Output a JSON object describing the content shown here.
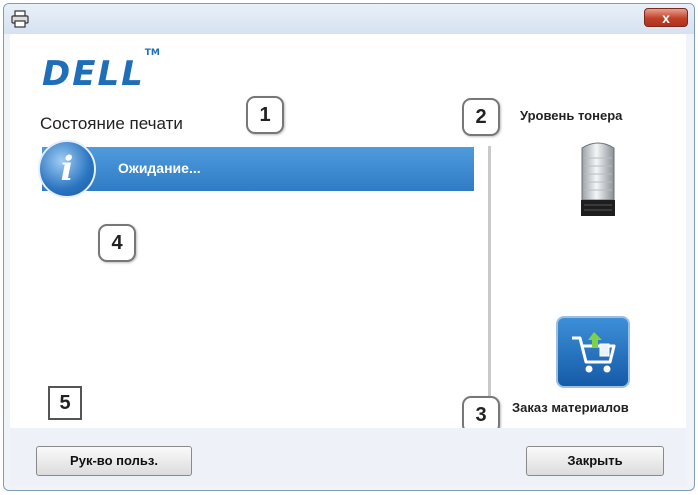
{
  "window": {
    "title_icon": "printer-icon",
    "close_label": "x"
  },
  "brand": {
    "logo_text": "DELL",
    "trademark": "TM"
  },
  "status_panel": {
    "heading": "Состояние печати",
    "status_icon": "info-icon",
    "status_icon_glyph": "i",
    "status_text": "Ожидание...",
    "status_bar_color": "#2f7cc5"
  },
  "toner": {
    "label": "Уровень тонера",
    "icon": "toner-cartridge-icon"
  },
  "supplies": {
    "label": "Заказ материалов",
    "icon": "shopping-cart-icon"
  },
  "callouts": [
    "1",
    "2",
    "3",
    "4",
    "5"
  ],
  "footer": {
    "guide_button": "Рук-во польз.",
    "close_button": "Закрыть"
  }
}
